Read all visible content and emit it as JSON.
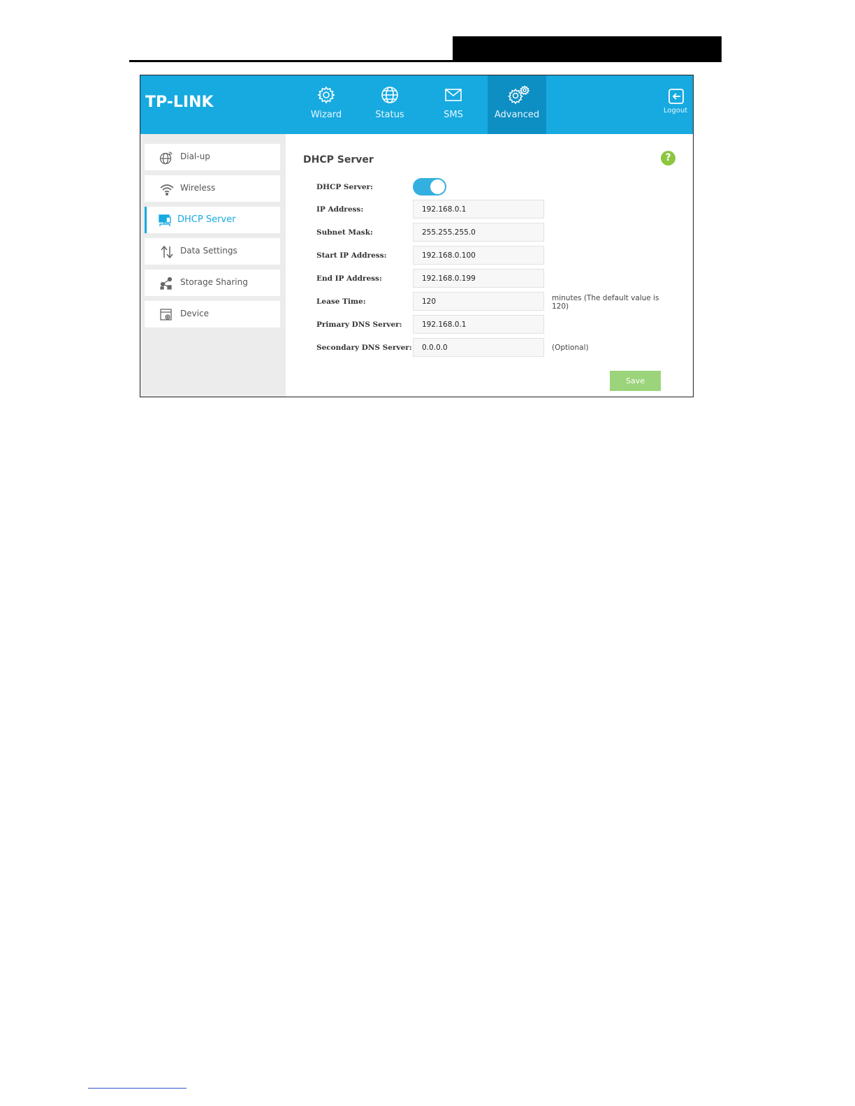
{
  "header": {
    "logo": "TP-LINK",
    "nav": [
      {
        "label": "Wizard",
        "icon": "gear-icon"
      },
      {
        "label": "Status",
        "icon": "globe-icon"
      },
      {
        "label": "SMS",
        "icon": "envelope-icon"
      },
      {
        "label": "Advanced",
        "icon": "gears-icon",
        "active": true
      }
    ],
    "logout_label": "Logout"
  },
  "sidebar": {
    "items": [
      {
        "label": "Dial-up",
        "icon": "globe-dial-icon"
      },
      {
        "label": "Wireless",
        "icon": "wifi-icon"
      },
      {
        "label": "DHCP Server",
        "icon": "network-monitor-icon",
        "active": true
      },
      {
        "label": "Data Settings",
        "icon": "up-down-arrows-icon"
      },
      {
        "label": "Storage Sharing",
        "icon": "share-icon"
      },
      {
        "label": "Device",
        "icon": "device-gear-icon"
      }
    ]
  },
  "main": {
    "title": "DHCP Server",
    "help_symbol": "?",
    "dhcp_label": "DHCP Server:",
    "dhcp_enabled": true,
    "fields": {
      "ip_address": {
        "label": "IP Address:",
        "value": "192.168.0.1"
      },
      "subnet_mask": {
        "label": "Subnet Mask:",
        "value": "255.255.255.0"
      },
      "start_ip": {
        "label": "Start IP Address:",
        "value": "192.168.0.100"
      },
      "end_ip": {
        "label": "End IP Address:",
        "value": "192.168.0.199"
      },
      "lease_time": {
        "label": "Lease Time:",
        "value": "120",
        "hint": "minutes (The default value is 120)"
      },
      "primary_dns": {
        "label": "Primary DNS Server:",
        "value": "192.168.0.1"
      },
      "secondary_dns": {
        "label": "Secondary DNS Server:",
        "value": "0.0.0.0",
        "hint": "(Optional)"
      }
    },
    "save_label": "Save"
  },
  "colors": {
    "brand_blue": "#16aae0",
    "active_nav": "#0d8fc4",
    "help_green": "#8cc63f",
    "save_green": "#9bd47a"
  }
}
